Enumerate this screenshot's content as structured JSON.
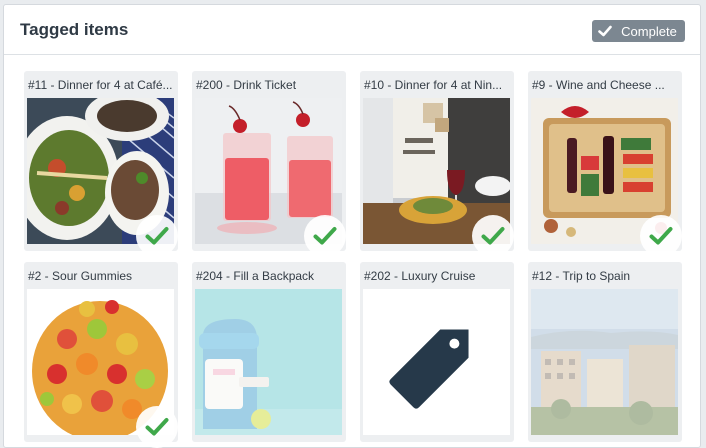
{
  "header": {
    "title": "Tagged items",
    "complete_label": "Complete"
  },
  "items": [
    {
      "label": "#11 - Dinner for 4 at Café...",
      "image": "dinner-plates-photo",
      "checked": true
    },
    {
      "label": "#200 - Drink Ticket",
      "image": "pink-drinks-photo",
      "checked": true
    },
    {
      "label": "#10 - Dinner for 4 at Nin...",
      "image": "restaurant-interior-photo",
      "checked": true
    },
    {
      "label": "#9 - Wine and Cheese ...",
      "image": "gift-basket-photo",
      "checked": true
    },
    {
      "label": "#2 - Sour Gummies",
      "image": "gummy-bears-photo",
      "checked": true
    },
    {
      "label": "#204 - Fill a Backpack",
      "image": "backpack-photo",
      "checked": false
    },
    {
      "label": "#202 - Luxury Cruise",
      "image": "tag-icon",
      "checked": false
    },
    {
      "label": "#12 - Trip to Spain",
      "image": "city-skyline-photo",
      "checked": false
    }
  ],
  "colors": {
    "check": "#3fa84a",
    "button": "#7c8791",
    "tag_icon": "#26394a"
  }
}
